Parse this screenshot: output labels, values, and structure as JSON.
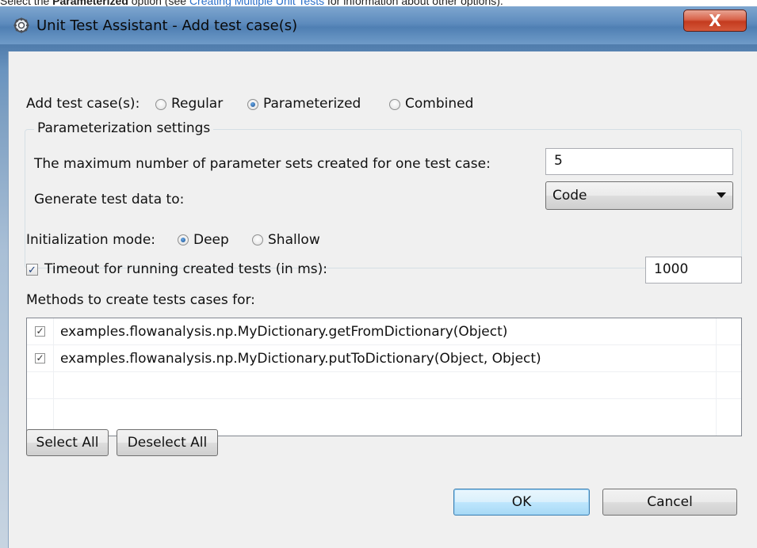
{
  "doc_text": {
    "prefix": "Select the ",
    "bold": "Parameterized",
    "mid": " option (see ",
    "link": "Creating Multiple Unit Tests",
    "suffix": " for information about other options)."
  },
  "window": {
    "title": "Unit Test Assistant - Add test case(s)",
    "close_label": "X"
  },
  "add_test_cases": {
    "label": "Add test case(s):",
    "options": [
      {
        "label": "Regular",
        "selected": false
      },
      {
        "label": "Parameterized",
        "selected": true
      },
      {
        "label": "Combined",
        "selected": false
      }
    ]
  },
  "parameterization": {
    "group_title": "Parameterization settings",
    "max_sets_label": "The maximum number of parameter sets created for one test case:",
    "max_sets_value": "5",
    "generate_label": "Generate test data to:",
    "generate_value": "Code"
  },
  "initialization": {
    "label": "Initialization mode:",
    "options": [
      {
        "label": "Deep",
        "selected": true
      },
      {
        "label": "Shallow",
        "selected": false
      }
    ]
  },
  "timeout": {
    "label": "Timeout for running created tests (in ms):",
    "checked": true,
    "value": "1000"
  },
  "methods": {
    "label": "Methods to create tests cases for:",
    "items": [
      {
        "label": "examples.flowanalysis.np.MyDictionary.getFromDictionary(Object)",
        "checked": true
      },
      {
        "label": "examples.flowanalysis.np.MyDictionary.putToDictionary(Object, Object)",
        "checked": true
      }
    ]
  },
  "buttons": {
    "select_all": "Select All",
    "deselect_all": "Deselect All",
    "ok": "OK",
    "cancel": "Cancel"
  },
  "colors": {
    "link": "#2a6fc9",
    "dialog_bg": "#f0f0f0",
    "title_bar": "#5d8bbd",
    "close_button": "#c43b1f"
  },
  "icons": {
    "check": "✓",
    "app": "gear-icon",
    "close": "close-icon"
  }
}
